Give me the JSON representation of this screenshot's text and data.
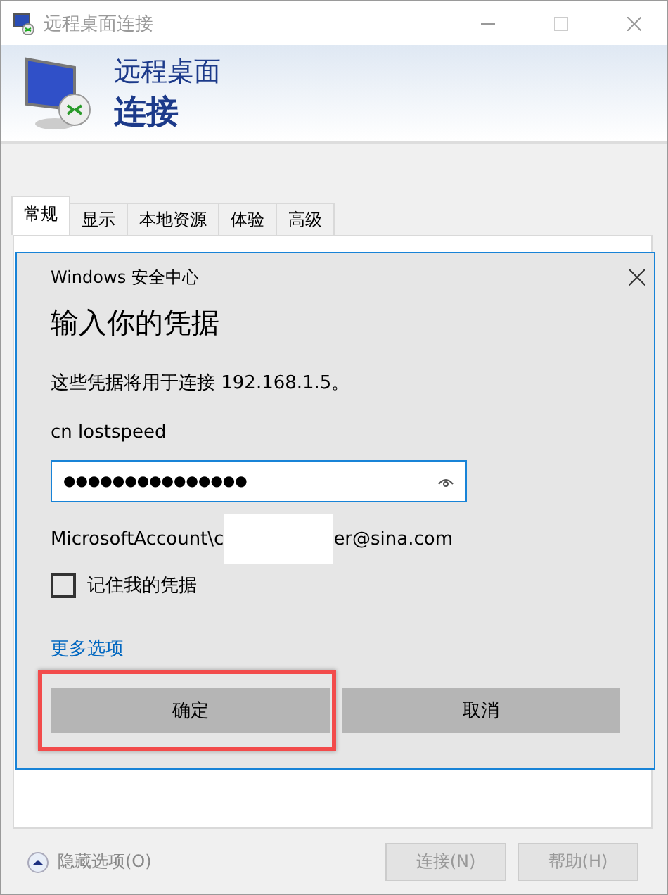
{
  "window": {
    "title": "远程桌面连接"
  },
  "header": {
    "line1": "远程桌面",
    "line2": "连接"
  },
  "tabs": [
    {
      "label": "常规",
      "selected": true
    },
    {
      "label": "显示",
      "selected": false
    },
    {
      "label": "本地资源",
      "selected": false
    },
    {
      "label": "体验",
      "selected": false
    },
    {
      "label": "高级",
      "selected": false
    }
  ],
  "dialog": {
    "caption": "Windows 安全中心",
    "title": "输入你的凭据",
    "message": "这些凭据将用于连接 192.168.1.5。",
    "username": "cn lostspeed",
    "password": {
      "value": "●●●●●●●●●●●●●●●"
    },
    "account": {
      "prefix": "MicrosoftAccount\\c",
      "redacted": true,
      "suffix": "er@sina.com"
    },
    "remember": {
      "label": "记住我的凭据",
      "checked": false
    },
    "more_link": "更多选项",
    "buttons": [
      {
        "label": "确定",
        "highlighted": true
      },
      {
        "label": "取消",
        "highlighted": false
      }
    ]
  },
  "hide_options": "隐藏选项(O)",
  "footer_buttons": [
    {
      "label": "连接(N)",
      "disabled": true
    },
    {
      "label": "帮助(H)",
      "disabled": true
    }
  ]
}
